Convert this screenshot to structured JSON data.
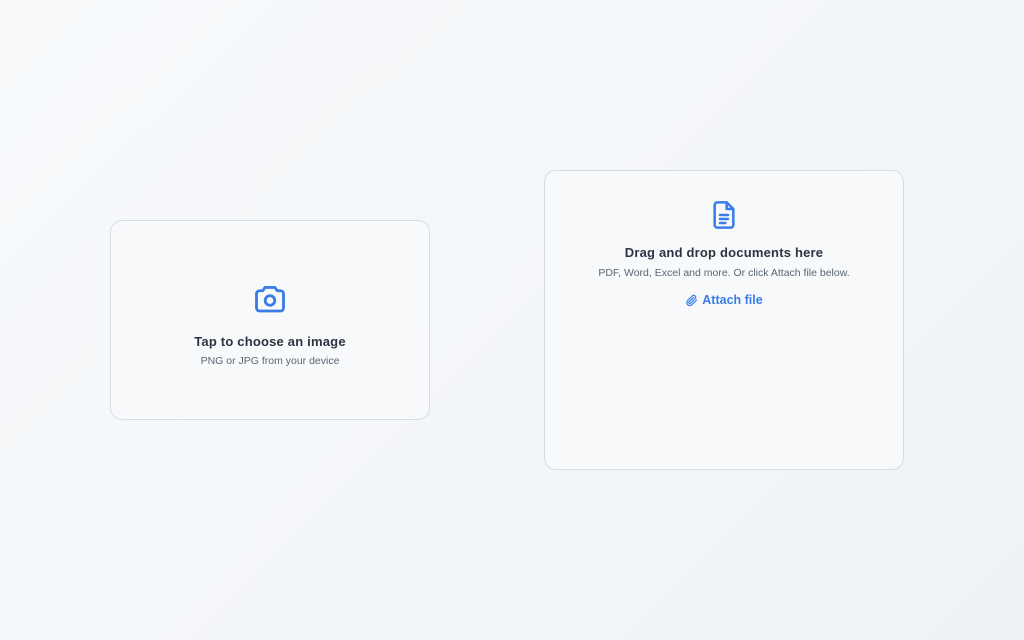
{
  "image_picker": {
    "icon": "camera-icon",
    "title": "Tap to choose an image",
    "subtitle": "PNG or JPG from your device"
  },
  "document_dropzone": {
    "icon": "document-icon",
    "title": "Drag and drop documents here",
    "subtitle": "PDF, Word, Excel and more. Or click Attach file below.",
    "attach_icon": "paperclip-icon",
    "attach_label": "Attach file"
  },
  "colors": {
    "accent": "#3b7de6",
    "card_border": "#d6dde5",
    "card_background": "#f7f9fb",
    "title_text": "#2a3442",
    "subtitle_text": "#5b6673"
  }
}
